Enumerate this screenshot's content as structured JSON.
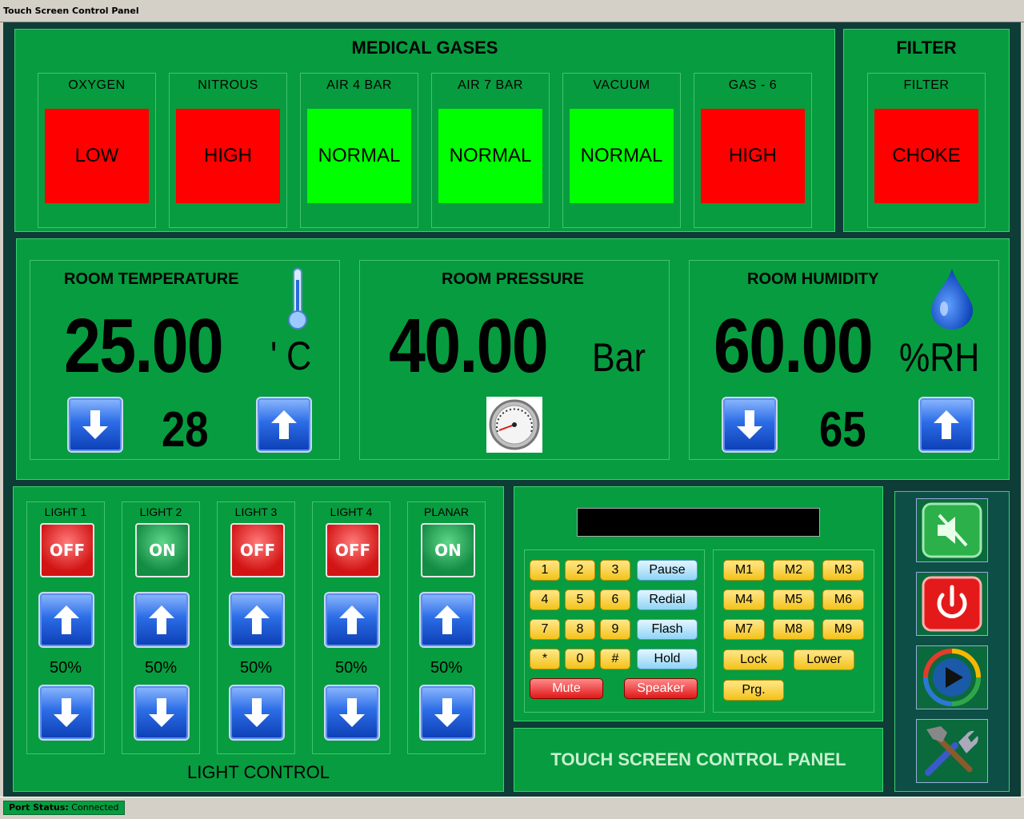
{
  "window": {
    "title": "Touch Screen Control Panel"
  },
  "medical_gases": {
    "title": "MEDICAL GASES",
    "gases": [
      {
        "label": "OXYGEN",
        "status": "LOW",
        "color": "#ff0000"
      },
      {
        "label": "NITROUS",
        "status": "HIGH",
        "color": "#ff0000"
      },
      {
        "label": "AIR 4 BAR",
        "status": "NORMAL",
        "color": "#00ff00"
      },
      {
        "label": "AIR 7 BAR",
        "status": "NORMAL",
        "color": "#00ff00"
      },
      {
        "label": "VACUUM",
        "status": "NORMAL",
        "color": "#00ff00"
      },
      {
        "label": "GAS - 6",
        "status": "HIGH",
        "color": "#ff0000"
      }
    ]
  },
  "filter": {
    "title": "FILTER",
    "label": "FILTER",
    "status": "CHOKE",
    "color": "#ff0000"
  },
  "room": {
    "temperature": {
      "title": "ROOM TEMPERATURE",
      "value": "25.00",
      "unit": "' C",
      "setpoint": "28",
      "icon": "thermometer-icon"
    },
    "pressure": {
      "title": "ROOM PRESSURE",
      "value": "40.00",
      "unit": "Bar",
      "icon": "pressure-gauge-icon"
    },
    "humidity": {
      "title": "ROOM HUMIDITY",
      "value": "60.00",
      "unit": "%RH",
      "setpoint": "65",
      "icon": "water-drop-icon"
    }
  },
  "light_control": {
    "title": "LIGHT CONTROL",
    "lights": [
      {
        "label": "LIGHT 1",
        "state": "OFF",
        "level": "50%"
      },
      {
        "label": "LIGHT 2",
        "state": "ON",
        "level": "50%"
      },
      {
        "label": "LIGHT 3",
        "state": "OFF",
        "level": "50%"
      },
      {
        "label": "LIGHT 4",
        "state": "OFF",
        "level": "50%"
      },
      {
        "label": "PLANAR",
        "state": "ON",
        "level": "50%"
      }
    ]
  },
  "phone": {
    "display": "",
    "keys": [
      "1",
      "2",
      "3",
      "4",
      "5",
      "6",
      "7",
      "8",
      "9",
      "*",
      "0",
      "#"
    ],
    "functions": [
      "Pause",
      "Redial",
      "Flash",
      "Hold"
    ],
    "mute": "Mute",
    "speaker": "Speaker",
    "memory": [
      "M1",
      "M2",
      "M3",
      "M4",
      "M5",
      "M6",
      "M7",
      "M8",
      "M9"
    ],
    "lock": "Lock",
    "lower": "Lower",
    "program": "Prg."
  },
  "banner": "TOUCH SCREEN CONTROL PANEL",
  "status": {
    "label": "Port Status:",
    "value": "Connected"
  }
}
